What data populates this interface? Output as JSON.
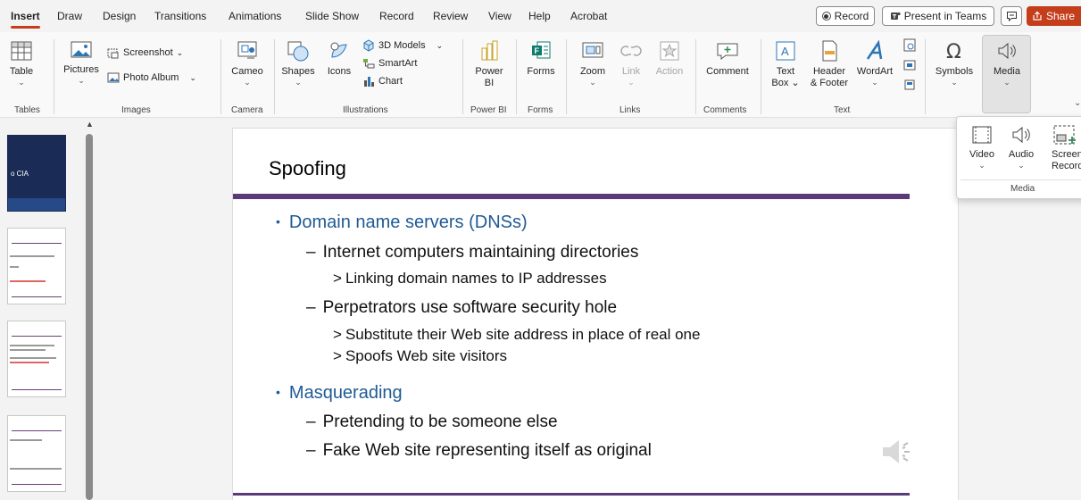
{
  "tabs": [
    "Insert",
    "Draw",
    "Design",
    "Transitions",
    "Animations",
    "Slide Show",
    "Record",
    "Review",
    "View",
    "Help",
    "Acrobat"
  ],
  "topright": {
    "record": "Record",
    "teams": "Present in Teams",
    "share": "Share"
  },
  "ribbon": {
    "table": "Table",
    "pictures": "Pictures",
    "screenshot": "Screenshot",
    "photo_album": "Photo Album",
    "cameo": "Cameo",
    "shapes": "Shapes",
    "icons": "Icons",
    "models3d": "3D Models",
    "smartart": "SmartArt",
    "chart": "Chart",
    "powerbi": [
      "Power",
      "BI"
    ],
    "forms": "Forms",
    "zoom": "Zoom",
    "link": "Link",
    "action": "Action",
    "comment": "Comment",
    "textbox": [
      "Text",
      "Box"
    ],
    "headerfooter": [
      "Header",
      "& Footer"
    ],
    "wordart": "WordArt",
    "symbols": "Symbols",
    "media": "Media"
  },
  "groups": [
    "Tables",
    "Images",
    "Camera",
    "Illustrations",
    "Power BI",
    "Forms",
    "Links",
    "Comments",
    "Text"
  ],
  "media_menu": {
    "video": "Video",
    "audio": "Audio",
    "screen": [
      "Screen",
      "Recording"
    ],
    "group": "Media"
  },
  "thumb_title": "o CIA",
  "slide": {
    "title": "Spoofing",
    "bullets": [
      {
        "level": 1,
        "bullet": "•",
        "text": "Domain name servers (DNSs)"
      },
      {
        "level": 2,
        "bullet": "–",
        "text": "Internet computers maintaining directories"
      },
      {
        "level": 3,
        "bullet": ">",
        "text": "Linking domain names to IP addresses"
      },
      {
        "level": 2,
        "bullet": "–",
        "text": "Perpetrators use software security hole"
      },
      {
        "level": 3,
        "bullet": ">",
        "text": "Substitute their Web site address in place of real one"
      },
      {
        "level": 3,
        "bullet": ">",
        "text": "Spoofs Web site visitors"
      },
      {
        "level": 1,
        "bullet": "•",
        "text": "Masquerading"
      },
      {
        "level": 2,
        "bullet": "–",
        "text": "Pretending to be someone else"
      },
      {
        "level": 2,
        "bullet": "–",
        "text": "Fake Web site representing itself as original"
      }
    ]
  },
  "colors": {
    "accent": "#c43e1c",
    "rule": "#5b3a7a",
    "level1": "#1f5a96"
  }
}
